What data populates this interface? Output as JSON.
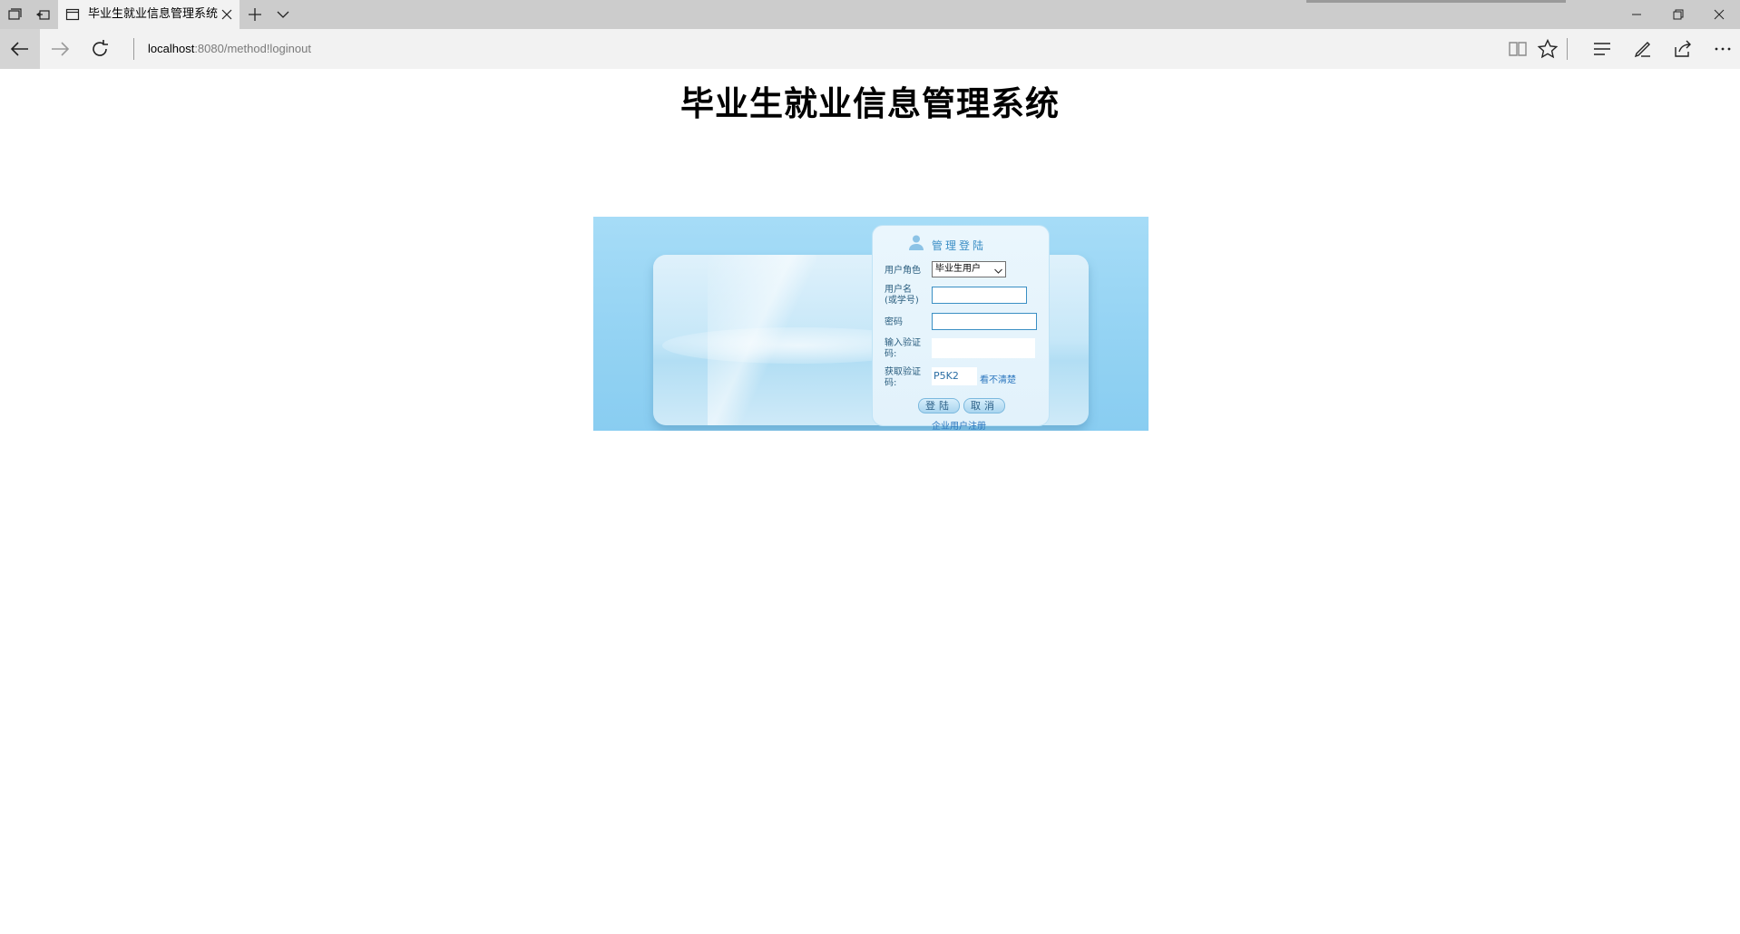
{
  "browser": {
    "tab": {
      "title": "毕业生就业信息管理系统"
    },
    "address": {
      "host": "localhost",
      "path": ":8080/method!loginout"
    }
  },
  "page": {
    "title": "毕业生就业信息管理系统",
    "login": {
      "heading": "管理登陆",
      "role_label": "用户角色",
      "role_value": "毕业生用户",
      "username_label_1": "用户名",
      "username_label_2": "(或学号)",
      "password_label": "密码",
      "captcha_input_label_1": "输入验证",
      "captcha_input_label_2": "码:",
      "captcha_get_label_1": "获取验证",
      "captcha_get_label_2": "码:",
      "captcha_code": "P5K2",
      "captcha_refresh": "看不清楚",
      "login_button": "登陆",
      "cancel_button": "取消",
      "register_link": "企业用户注册"
    }
  }
}
